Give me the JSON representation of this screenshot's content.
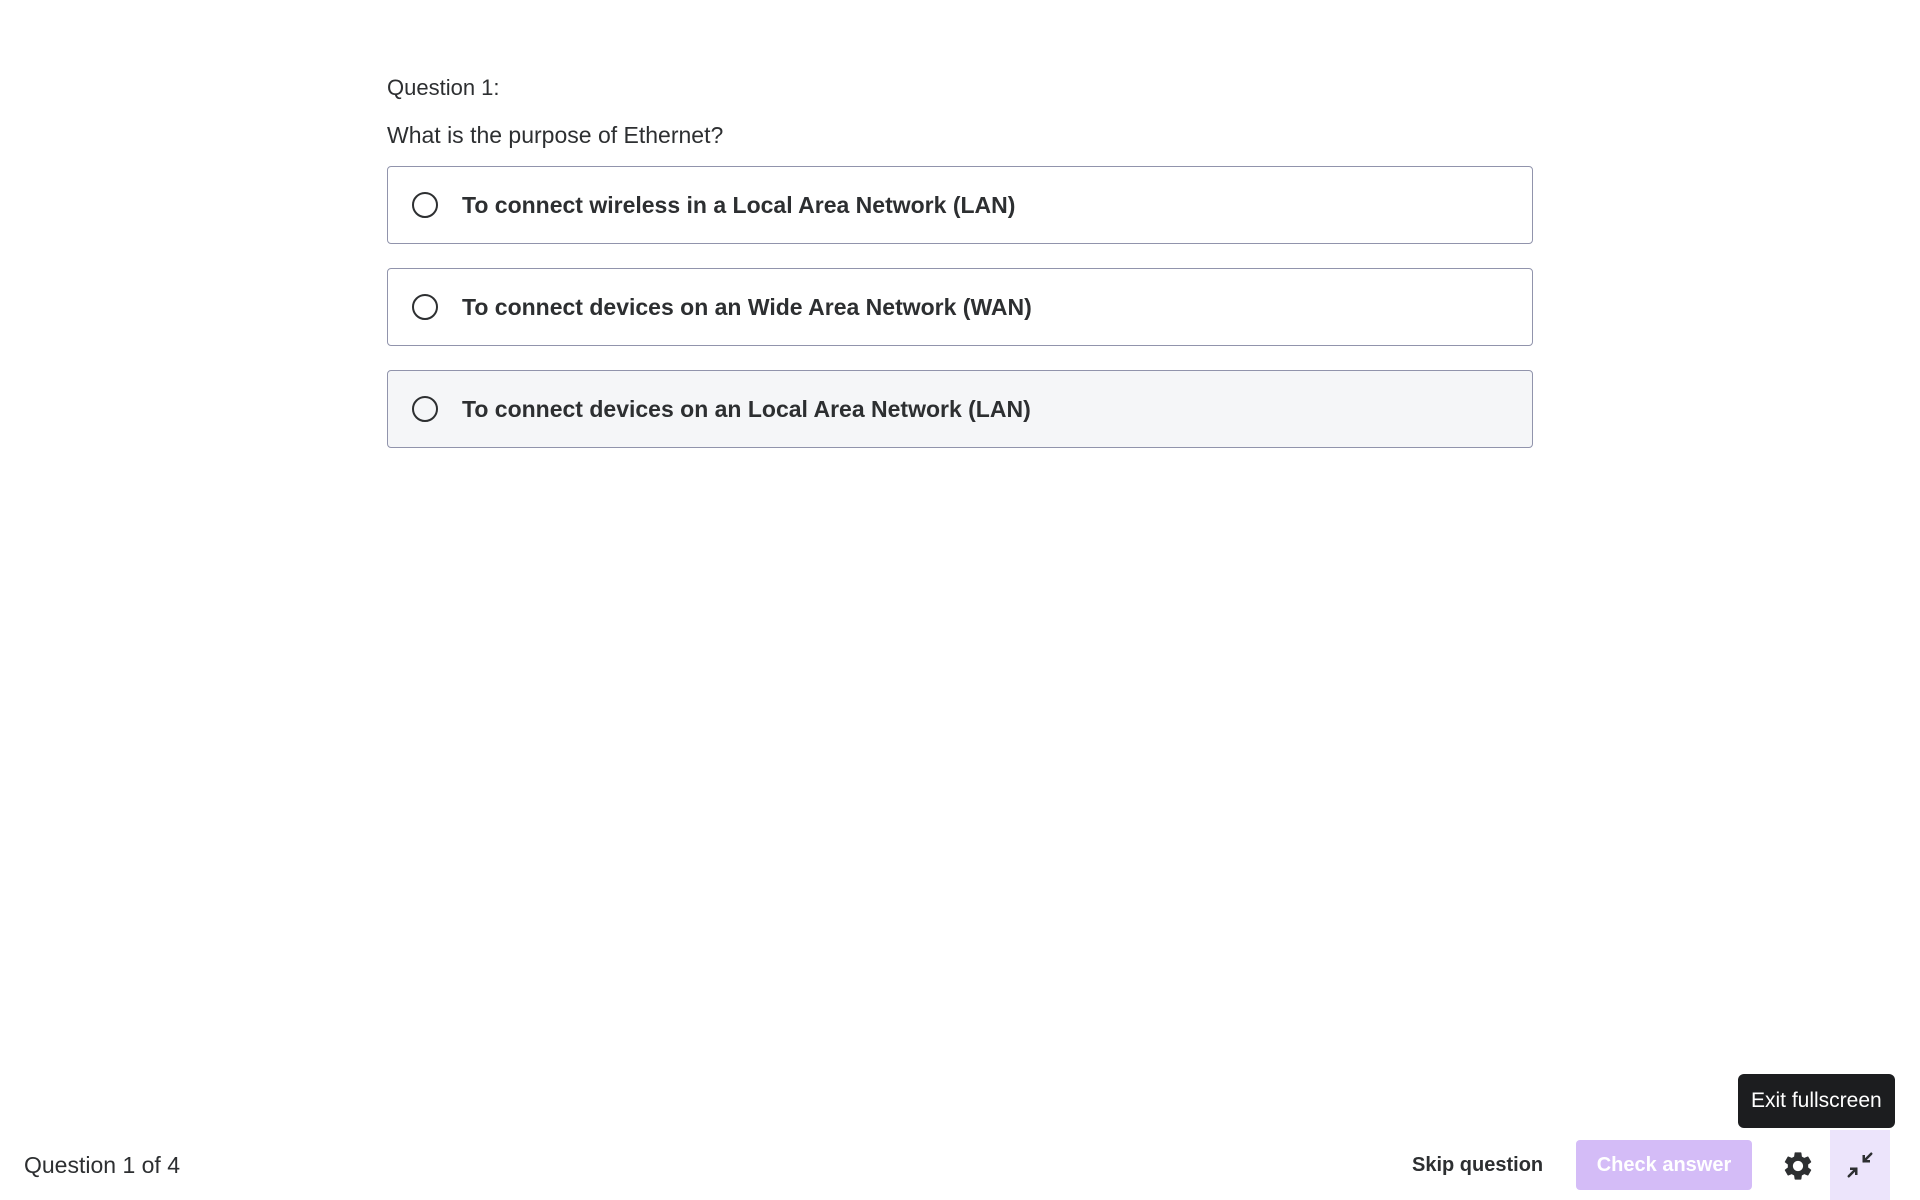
{
  "question": {
    "number_label": "Question 1:",
    "text": "What is the purpose of Ethernet?",
    "options": [
      {
        "label": "To connect wireless in a Local Area Network (LAN)"
      },
      {
        "label": "To connect devices on an Wide Area Network (WAN)"
      },
      {
        "label": "To connect devices on an Local Area Network (LAN)"
      }
    ]
  },
  "footer": {
    "progress": "Question 1 of 4",
    "skip_label": "Skip question",
    "check_label": "Check answer",
    "settings_icon": "gear-icon",
    "exit_icon": "exit-fullscreen-icon",
    "tooltip": "Exit fullscreen"
  },
  "colors": {
    "check_button_disabled": "#d4bcf7",
    "exit_button_bg": "#ece4fb",
    "tooltip_bg": "#1c1d1f",
    "option_border": "#9194ac",
    "option_hover_bg": "#f5f6f8"
  }
}
